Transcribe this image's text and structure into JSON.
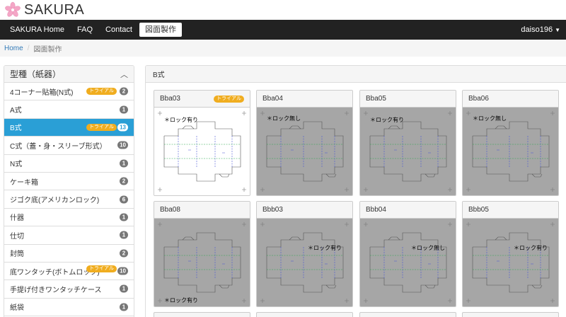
{
  "brand": {
    "name": "SAKURA"
  },
  "nav": {
    "items": [
      "SAKURA Home",
      "FAQ",
      "Contact",
      "図面製作"
    ],
    "user": "daiso196"
  },
  "breadcrumb": {
    "home": "Home",
    "current": "図面製作"
  },
  "sidebar": {
    "title": "型種（紙器）",
    "items": [
      {
        "label": "4コーナー貼箱(N式)",
        "count": "2",
        "trial": "トライアル"
      },
      {
        "label": "A式",
        "count": "1"
      },
      {
        "label": "B式",
        "count": "13",
        "trial": "トライアル",
        "active": true
      },
      {
        "label": "C式（蓋・身・スリーブ形式）",
        "count": "10"
      },
      {
        "label": "N式",
        "count": "1"
      },
      {
        "label": "ケーキ箱",
        "count": "2"
      },
      {
        "label": "ジゴク底(アメリカンロック)",
        "count": "6"
      },
      {
        "label": "什器",
        "count": "1"
      },
      {
        "label": "仕切",
        "count": "1"
      },
      {
        "label": "封筒",
        "count": "2"
      },
      {
        "label": "底ワンタッチ(ボトムロック)",
        "count": "10",
        "trial": "トライアル"
      },
      {
        "label": "手提げ付きワンタッチケース",
        "count": "1"
      },
      {
        "label": "紙袋",
        "count": "1"
      }
    ]
  },
  "main": {
    "title": "B式",
    "cards": [
      {
        "name": "Bba03",
        "trial": "トライアル",
        "lock": "＊ロック有り",
        "enabled": true
      },
      {
        "name": "Bba04",
        "lock": "＊ロック無し"
      },
      {
        "name": "Bba05",
        "lock": "＊ロック有り"
      },
      {
        "name": "Bba06",
        "lock": "＊ロック無し"
      },
      {
        "name": "Bba08",
        "lock": "＊ロック有り"
      },
      {
        "name": "Bbb03",
        "lock": "＊ロック有り"
      },
      {
        "name": "Bbb04",
        "lock": "＊ロック無し"
      },
      {
        "name": "Bbb05",
        "lock": "＊ロック有り"
      }
    ]
  },
  "colors": {
    "accent": "#2a9fd6",
    "trial": "#f0ad1f",
    "navbar": "#222222",
    "disabled_bg": "#a6a6a6"
  }
}
